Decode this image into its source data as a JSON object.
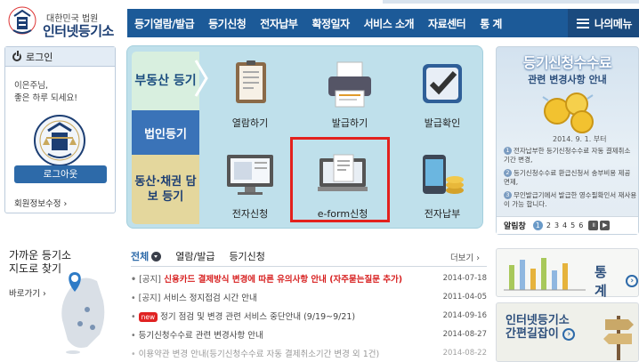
{
  "header": {
    "court_name": "대한민국 법원",
    "site_title": "인터넷등기소",
    "nav": [
      "등기열람/발급",
      "등기신청",
      "전자납부",
      "확정일자",
      "서비스 소개",
      "자료센터",
      "통 계"
    ],
    "my_menu": "나의메뉴"
  },
  "login": {
    "title": "로그인",
    "greeting_line1": "이은주님,",
    "greeting_line2": "좋은 하루 되세요!",
    "logout_button": "로그아웃",
    "member_info": "회원정보수정"
  },
  "quick": {
    "tabs": [
      "부동산 등기",
      "법인등기",
      "동산·채권 담보 등기"
    ],
    "items": [
      "열람하기",
      "발급하기",
      "발급확인",
      "전자신청",
      "e-form신청",
      "전자납부"
    ]
  },
  "promo": {
    "title": "등기신청수수료",
    "subtitle": "관련 변경사항 안내",
    "date": "2014. 9. 1. 부터",
    "points": [
      "전자납부한 등기신청수수료 자동 결제취소 기간 변경,",
      "등기신청수수료 환급신청서 송부비용 제공 면제,",
      "무인발급기에서 발급한 영수필확인서 재사용이 가능 합니다."
    ],
    "carousel_label": "알림창",
    "pages": [
      "1",
      "2",
      "3",
      "4",
      "5",
      "6"
    ],
    "active_page": "1"
  },
  "near": {
    "title_line1": "가까운 등기소",
    "title_line2": "지도로 찾기",
    "go_link": "바로가기"
  },
  "notice": {
    "tabs": [
      "전체",
      "열람/발급",
      "등기신청"
    ],
    "more": "더보기",
    "rows": [
      {
        "prefix": "[공지]",
        "title": "신용카드 결제방식 변경에 따른 유의사항 안내 (자주묻는질문 추가)",
        "date": "2014-07-18",
        "highlight": true
      },
      {
        "prefix": "[공지]",
        "title": "서비스 정지접검 시간 안내",
        "date": "2011-04-05",
        "highlight": false
      },
      {
        "prefix": "new",
        "title": "정기 점검 및 변경 관련 서비스 중단안내 (9/19~9/21)",
        "date": "2014-09-16",
        "highlight": false
      },
      {
        "prefix": "",
        "title": "등기신청수수료 관련 변경사항 안내",
        "date": "2014-08-27",
        "highlight": false
      },
      {
        "prefix": "",
        "title": "이용약관 변경 안내(등기신청수수료 자동 결제취소기간 변경 외 1건)",
        "date": "2014-08-22",
        "highlight": false
      }
    ]
  },
  "stats": {
    "title": "통 계"
  },
  "guide": {
    "title_line1": "인터넷등기소",
    "title_line2": "간편길잡이"
  },
  "colors": {
    "nav_bg": "#1c5a98",
    "quick_bg": "#bfe0eb",
    "highlight_border": "#e3211d",
    "notice_red": "#d71f1f"
  }
}
